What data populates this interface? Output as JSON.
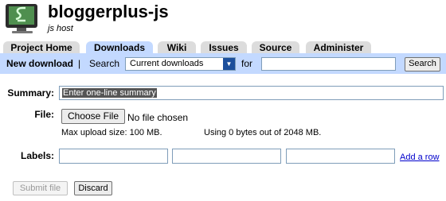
{
  "header": {
    "project_name": "bloggerplus-js",
    "project_summary": "js host",
    "logo_icon": "monitor-logo-icon"
  },
  "tabs": [
    {
      "label": "Project Home",
      "active": false
    },
    {
      "label": "Downloads",
      "active": true
    },
    {
      "label": "Wiki",
      "active": false
    },
    {
      "label": "Issues",
      "active": false
    },
    {
      "label": "Source",
      "active": false
    },
    {
      "label": "Administer",
      "active": false
    }
  ],
  "subbar": {
    "new_download": "New download",
    "separator": "|",
    "search_label": "Search",
    "search_scope": "Current downloads",
    "for_label": "for",
    "query_value": "",
    "search_button": "Search"
  },
  "form": {
    "summary_label": "Summary:",
    "summary_placeholder": "Enter one-line summary",
    "file_label": "File:",
    "file_button": "Choose File",
    "file_status": "No file chosen",
    "max_upload": "Max upload size: 100 MB.",
    "usage": "Using 0 bytes out of 2048 MB.",
    "labels_label": "Labels:",
    "label_values": [
      "",
      "",
      ""
    ],
    "add_row": "Add a row",
    "submit": "Submit file",
    "discard": "Discard"
  },
  "colors": {
    "accent": "#c3d9ff",
    "tab_inactive": "#dcdcdc",
    "link": "#0000cc"
  }
}
